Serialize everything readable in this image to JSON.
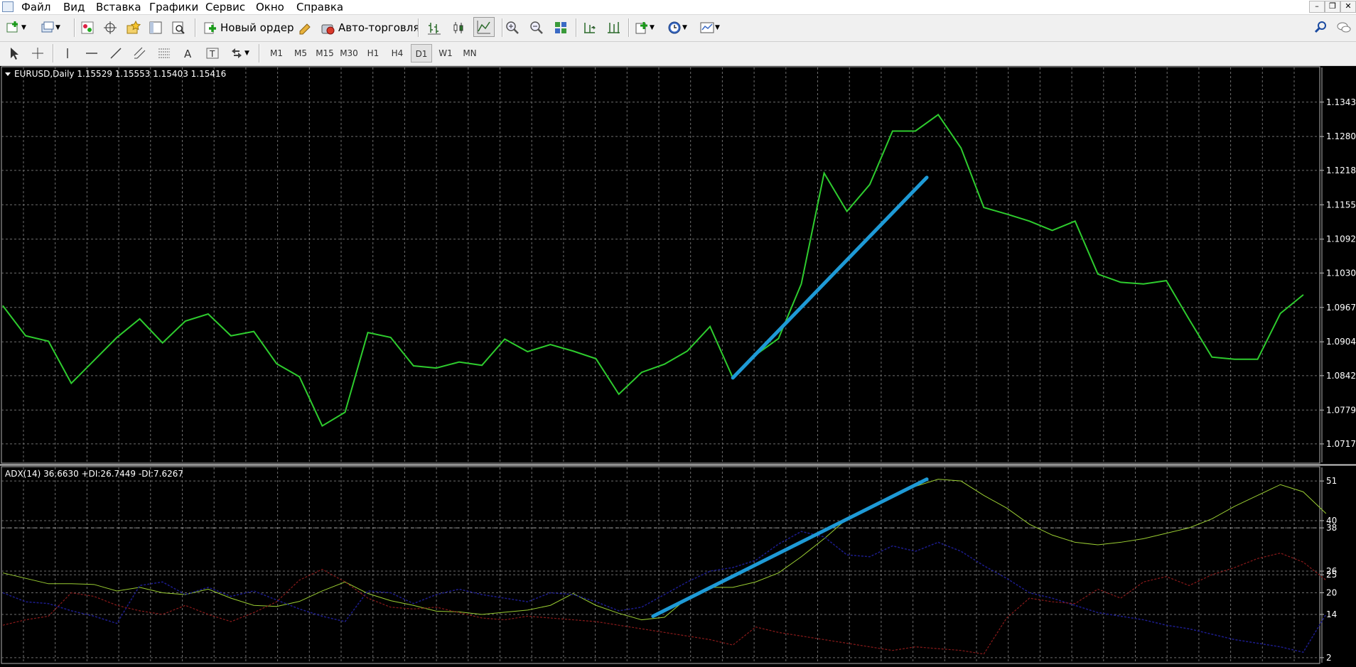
{
  "menu": {
    "items": [
      "Файл",
      "Вид",
      "Вставка",
      "Графики",
      "Сервис",
      "Окно",
      "Справка"
    ]
  },
  "window_controls": [
    "–",
    "❐",
    "✕"
  ],
  "toolbar": {
    "new_order_label": "Новый ордер",
    "auto_trading_label": "Авто-торговля"
  },
  "timeframes": [
    "M1",
    "M5",
    "M15",
    "M30",
    "H1",
    "H4",
    "D1",
    "W1",
    "MN"
  ],
  "active_timeframe": "D1",
  "colors": {
    "price_line": "#2ecc2e",
    "adx_line": "#9acd32",
    "plus_di": "#1c1c8c",
    "minus_di": "#8b1a1a",
    "trend_line": "#1e9ad6",
    "grid": "#6e6e6e"
  },
  "chart_data": [
    {
      "type": "line",
      "title": "EURUSD,Daily  1.15529 1.15553 1.15403 1.15416",
      "series": [
        {
          "values": [
            1.097,
            1.0915,
            1.0905,
            1.0828,
            1.087,
            1.0912,
            1.0946,
            1.0902,
            1.0942,
            1.0955,
            1.0915,
            1.0923,
            1.0864,
            1.084,
            1.075,
            1.0775,
            1.0921,
            1.0912,
            1.086,
            1.0856,
            1.0867,
            1.0861,
            1.0909,
            1.0886,
            1.0899,
            1.0887,
            1.0873,
            1.0808,
            1.0848,
            1.0863,
            1.0887,
            1.0932,
            1.0838,
            1.088,
            1.091,
            1.101,
            1.1213,
            1.1143,
            1.1192,
            1.129,
            1.129,
            1.132,
            1.1259,
            1.115,
            1.1138,
            1.1125,
            1.1108,
            1.1125,
            1.1028,
            1.1013,
            1.101,
            1.1016,
            1.0945,
            1.0876,
            1.0872,
            1.0872,
            1.0956,
            1.099
          ]
        }
      ],
      "y_ticks": [
        "1.13430",
        "1.12800",
        "1.12180",
        "1.11550",
        "1.10920",
        "1.10300",
        "1.09670",
        "1.09040",
        "1.08420",
        "1.07790",
        "1.07170"
      ],
      "ylim": [
        1.07,
        1.137
      ],
      "grid": true,
      "annotations": [
        {
          "type": "trend-line",
          "from": [
            32,
            1.0838
          ],
          "to": [
            40.5,
            1.1205
          ]
        }
      ]
    },
    {
      "type": "line",
      "title": "ADX(14) 36.6630 +DI:26.7449 -DI:7.6267",
      "series": [
        {
          "values": [
            25.5,
            24,
            22.5,
            22.5,
            22.3,
            20.5,
            21.5,
            20,
            19.5,
            21,
            18.5,
            16.5,
            16.2,
            17.6,
            20.5,
            23,
            19.8,
            17.8,
            16.5,
            14.9,
            14.7,
            14,
            14.6,
            15.2,
            16.5,
            19.8,
            16.5,
            14.3,
            12.5,
            13.2,
            18.5,
            21.5,
            21.5,
            23,
            25.5,
            30,
            35,
            40.5,
            43.5,
            46.5,
            49.5,
            51.5,
            51,
            47,
            43.5,
            39,
            36,
            34,
            33.3,
            34,
            35,
            36.5,
            38,
            40.5,
            44,
            47,
            50,
            48,
            42
          ]
        },
        {
          "values": [
            20,
            17.5,
            17,
            15,
            13.5,
            11.5,
            22,
            23,
            19.5,
            21.5,
            19,
            20.5,
            18,
            15.5,
            13.5,
            12,
            20.5,
            20,
            17,
            19.5,
            21,
            19.5,
            18.5,
            17.5,
            20,
            19.5,
            17.5,
            15,
            16,
            19.5,
            23,
            26,
            27,
            29,
            33.5,
            37,
            35.5,
            30.5,
            30,
            33,
            31.5,
            34,
            31.5,
            27.5,
            24,
            20,
            18.5,
            16.5,
            14.5,
            13.5,
            12.5,
            11,
            10,
            8.5,
            7,
            6,
            5,
            3.5,
            14
          ]
        },
        {
          "values": [
            11,
            12.5,
            13.5,
            20,
            19,
            16.5,
            15,
            14,
            16.5,
            14,
            12,
            14.5,
            17.5,
            23.5,
            26.5,
            23,
            18.5,
            16,
            15.5,
            16,
            14.5,
            13,
            12.5,
            13.5,
            13,
            12.5,
            12,
            11,
            10,
            9,
            8,
            7,
            5.5,
            10.5,
            9,
            8,
            7,
            6,
            5,
            4,
            5,
            4.5,
            4,
            3,
            13,
            18.5,
            17.5,
            17,
            21,
            18.5,
            23,
            24.5,
            22,
            25,
            27,
            29.5,
            31,
            28.5,
            23.5
          ]
        }
      ],
      "y_ticks": [
        "51",
        "40",
        "38",
        "26",
        "25",
        "20",
        "14",
        "2"
      ],
      "ylim": [
        0,
        53
      ],
      "levels": [
        38
      ],
      "grid": true,
      "annotations": [
        {
          "type": "trend-line",
          "from": [
            28.5,
            13.5
          ],
          "to": [
            40.5,
            51.5
          ]
        }
      ]
    }
  ]
}
